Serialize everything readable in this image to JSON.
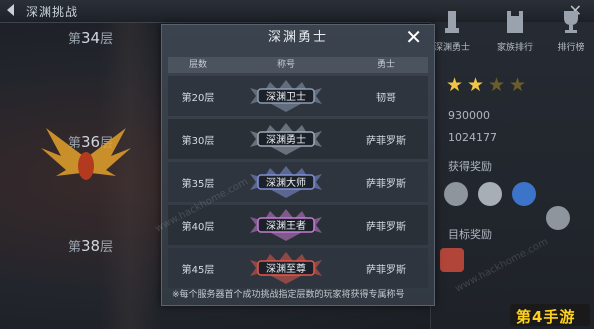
{
  "header": {
    "title": "深渊挑战",
    "close": "✕"
  },
  "floors": [
    {
      "prefix": "第",
      "num": "34",
      "suffix": "层"
    },
    {
      "prefix": "第",
      "num": "36",
      "suffix": "层"
    },
    {
      "prefix": "第",
      "num": "38",
      "suffix": "层"
    }
  ],
  "right_panel": {
    "buttons": [
      "深渊勇士",
      "家族排行",
      "排行榜"
    ],
    "stars": {
      "filled": 2,
      "total": 4
    },
    "values": [
      "930000",
      "1024177"
    ],
    "reward_label": "获得奖励",
    "target_label": "目标奖励"
  },
  "modal": {
    "title": "深渊勇士",
    "close": "✕",
    "headers": [
      "层数",
      "称号",
      "勇士"
    ],
    "rows": [
      {
        "floor": "第20层",
        "title": "深渊卫士",
        "warrior": "韧哥",
        "color": "#8a9bb0"
      },
      {
        "floor": "第30层",
        "title": "深渊勇士",
        "warrior": "萨菲罗斯",
        "color": "#9ea7b5"
      },
      {
        "floor": "第35层",
        "title": "深渊大师",
        "warrior": "萨菲罗斯",
        "color": "#7f8fd6"
      },
      {
        "floor": "第40层",
        "title": "深渊王者",
        "warrior": "萨菲罗斯",
        "color": "#c47cd1"
      },
      {
        "floor": "第45层",
        "title": "深渊至尊",
        "warrior": "萨菲罗斯",
        "color": "#e0584c"
      }
    ],
    "footnote": "※每个服务器首个成功挑战指定层数的玩家将获得专属称号"
  },
  "watermark": "www.hackhome.com",
  "logo": "第4手游"
}
